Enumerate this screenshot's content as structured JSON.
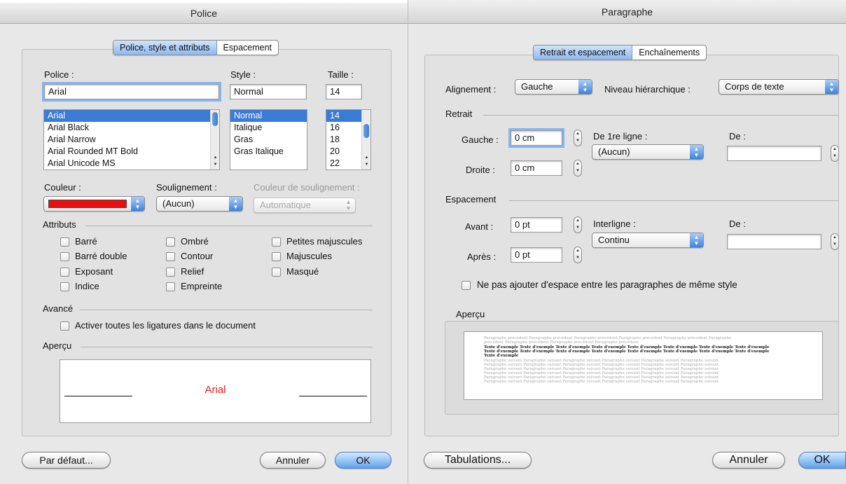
{
  "police": {
    "title": "Police",
    "tabs": [
      {
        "label": "Police, style et attributs",
        "active": true
      },
      {
        "label": "Espacement",
        "active": false
      }
    ],
    "font_label": "Police :",
    "style_label": "Style :",
    "size_label": "Taille :",
    "font_value": "Arial",
    "style_value": "Normal",
    "size_value": "14",
    "fonts": [
      "Arial",
      "Arial Black",
      "Arial Narrow",
      "Arial Rounded MT Bold",
      "Arial Unicode MS"
    ],
    "styles": [
      "Normal",
      "Italique",
      "Gras",
      "Gras Italique"
    ],
    "sizes": [
      "14",
      "16",
      "18",
      "20",
      "22"
    ],
    "color_label": "Couleur :",
    "color_value": "#e8100f",
    "underline_label": "Soulignement :",
    "underline_value": "(Aucun)",
    "underline_color_label": "Couleur de soulignement :",
    "underline_color_value": "Automatique",
    "attributes_label": "Attributs",
    "attributes": {
      "col1": [
        "Barré",
        "Barré double",
        "Exposant",
        "Indice"
      ],
      "col2": [
        "Ombré",
        "Contour",
        "Relief",
        "Empreinte"
      ],
      "col3": [
        "Petites majuscules",
        "Majuscules",
        "Masqué"
      ]
    },
    "advanced_label": "Avancé",
    "ligatures_label": "Activer toutes les ligatures dans le document",
    "preview_label": "Aperçu",
    "preview_text": "Arial",
    "preview_color": "#e0201c",
    "default_button": "Par défaut...",
    "cancel_button": "Annuler",
    "ok_button": "OK"
  },
  "paragraphe": {
    "title": "Paragraphe",
    "tabs": [
      {
        "label": "Retrait et espacement",
        "active": true
      },
      {
        "label": "Enchaînements",
        "active": false
      }
    ],
    "alignment_label": "Alignement :",
    "alignment_value": "Gauche",
    "level_label": "Niveau hiérarchique :",
    "level_value": "Corps de texte",
    "indent_label": "Retrait",
    "left_label": "Gauche :",
    "left_value": "0 cm",
    "right_label": "Droite :",
    "right_value": "0 cm",
    "first_line_label": "De 1re ligne :",
    "first_line_value": "(Aucun)",
    "indent_by_label": "De :",
    "indent_by_value": "",
    "spacing_label": "Espacement",
    "before_label": "Avant :",
    "before_value": "0 pt",
    "after_label": "Après :",
    "after_value": "0 pt",
    "line_spacing_label": "Interligne :",
    "line_spacing_value": "Continu",
    "line_by_label": "De :",
    "line_by_value": "",
    "no_space_label": "Ne pas ajouter d'espace entre les paragraphes de même style",
    "preview_label": "Aperçu",
    "preview_lines": {
      "before": [
        "Paragraphe précédent Paragraphe précédent Paragraphe précédent Paragraphe précédent Paragraphe précédent Paragraphe",
        "précédent Paragraphe précédent Paragraphe précédent Paragraphe précédent"
      ],
      "sample": [
        "Texte d'exemple Texte d'exemple Texte d'exemple Texte d'exemple Texte d'exemple Texte d'exemple Texte d'exemple Texte d'exemple",
        "Texte d'exemple Texte d'exemple Texte d'exemple Texte d'exemple Texte d'exemple Texte d'exemple Texte d'exemple Texte d'exemple",
        "Texte d'exemple"
      ],
      "after": [
        "Paragraphe suivant Paragraphe suivant Paragraphe suivant Paragraphe suivant Paragraphe suivant Paragraphe suivant",
        "Paragraphe suivant Paragraphe suivant Paragraphe suivant Paragraphe suivant Paragraphe suivant Paragraphe suivant",
        "Paragraphe suivant Paragraphe suivant Paragraphe suivant Paragraphe suivant Paragraphe suivant Paragraphe suivant",
        "Paragraphe suivant Paragraphe suivant Paragraphe suivant Paragraphe suivant Paragraphe suivant Paragraphe suivant",
        "Paragraphe suivant Paragraphe suivant Paragraphe suivant Paragraphe suivant Paragraphe suivant Paragraphe suivant",
        "Paragraphe suivant Paragraphe suivant Paragraphe suivant Paragraphe suivant Paragraphe suivant Paragraphe suivant"
      ]
    },
    "tabs_button": "Tabulations...",
    "cancel_button": "Annuler",
    "ok_button": "OK"
  },
  "icons": {
    "popup_arrows": "updown-arrows-icon",
    "stepper": "stepper-arrows-icon",
    "checkbox": "checkbox-icon"
  }
}
